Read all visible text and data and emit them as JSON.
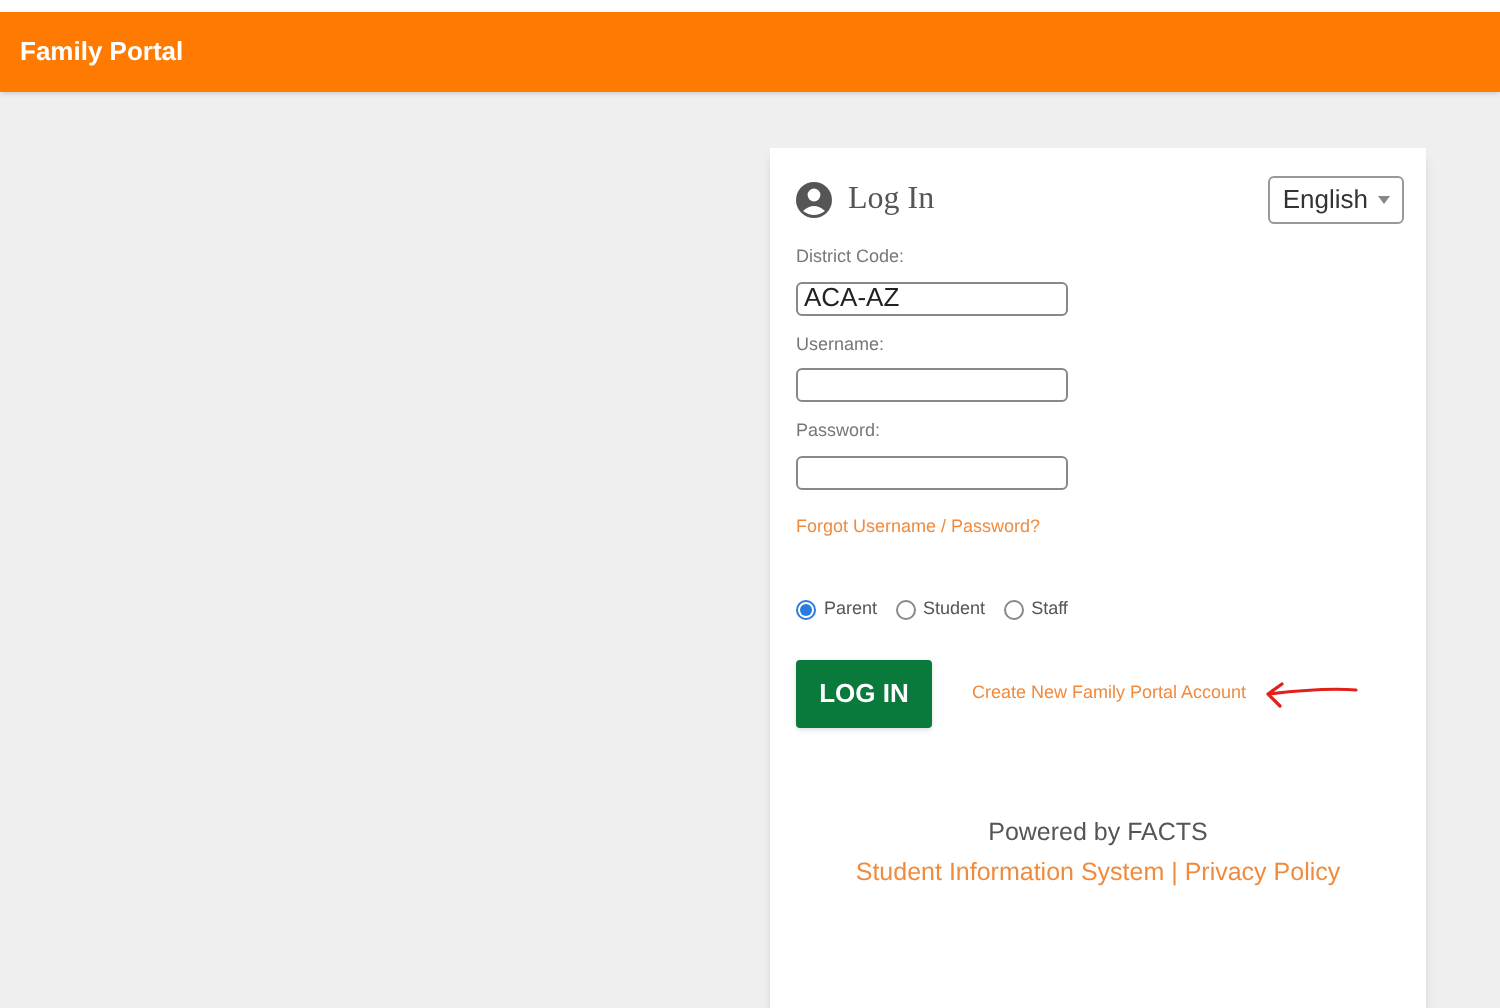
{
  "header": {
    "title": "Family Portal"
  },
  "login": {
    "title": "Log In",
    "language": "English",
    "fields": [
      {
        "label": "District Code:",
        "value": "ACA-AZ"
      },
      {
        "label": "Username:"
      },
      {
        "label": "Password:"
      }
    ],
    "forgot_link": "Forgot Username / Password?",
    "roles": [
      {
        "label": "Parent",
        "selected": true
      },
      {
        "label": "Student",
        "selected": false
      },
      {
        "label": "Staff",
        "selected": false
      }
    ],
    "login_button": "LOG IN",
    "create_account_link": "Create New Family Portal Account",
    "footer": {
      "prefix": "Powered by FACTS",
      "link": "Student Information System",
      "separator": "|",
      "privacy_link": "Privacy Policy"
    }
  }
}
